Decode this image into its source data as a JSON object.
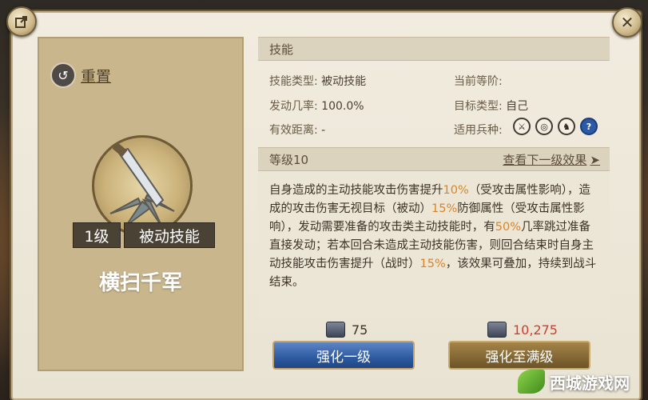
{
  "left": {
    "reset_label": "重置",
    "level_tag": "1级",
    "type_tag": "被动技能",
    "skill_name": "横扫千军"
  },
  "skill_section": {
    "title": "技能",
    "attributes": [
      {
        "key": "技能类型:",
        "value": "被动技能"
      },
      {
        "key": "当前等阶:",
        "value": ""
      },
      {
        "key": "发动几率:",
        "value": "100.0%"
      },
      {
        "key": "目标类型:",
        "value": "自己"
      },
      {
        "key": "有效距离:",
        "value": "-"
      },
      {
        "key": "适用兵种:",
        "value": ""
      }
    ],
    "unit_icons": [
      "sword-unit-icon",
      "shield-unit-icon",
      "horse-unit-icon",
      "help-icon"
    ]
  },
  "level_section": {
    "title": "等级10",
    "next_link": "查看下一级效果",
    "description": {
      "p1": "自身造成的主动技能攻击伤害提升",
      "h1": "10%",
      "p2": "（受攻击属性影响），造成的攻击伤害无视目标（被动）",
      "h2": "15%",
      "p3": "防御属性（受攻击属性影响），发动需要准备的攻击类主动技能时，有",
      "h3": "50%",
      "p4": "几率跳过准备直接发动；若本回合未造成主动技能伤害，则回合结束时自身主动技能攻击伤害提升（战时）",
      "h4": "15%",
      "p5": "，该效果可叠加，持续到战斗结束。"
    }
  },
  "costs": {
    "upgrade_one": "75",
    "upgrade_max": "10,275"
  },
  "buttons": {
    "upgrade_one": "强化一级",
    "upgrade_max": "强化至满级"
  },
  "watermark": "西城游戏网",
  "colors": {
    "highlight": "#d7842c",
    "cost_red": "#d23d2c",
    "blue_button": "#2d5aa0",
    "gold_button": "#6c5428"
  }
}
